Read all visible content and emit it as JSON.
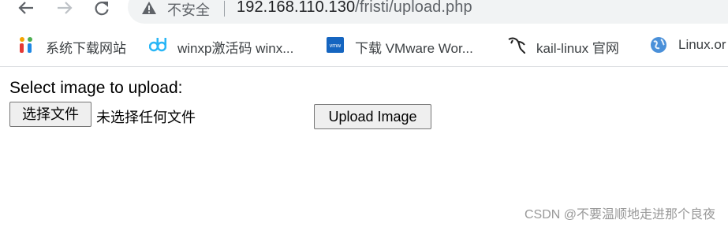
{
  "browser": {
    "security_label": "不安全",
    "url_host": "192.168.110.130",
    "url_path": "/fristi/upload.php"
  },
  "bookmarks": [
    {
      "label": "系统下载网站",
      "icon": "system-download-icon"
    },
    {
      "label": "winxp激活码 winx...",
      "icon": "winxp-icon"
    },
    {
      "label": "下载 VMware Wor...",
      "icon": "vmware-icon"
    },
    {
      "label": "kail-linux 官网",
      "icon": "kali-dragon-icon"
    },
    {
      "label": "Linux.or",
      "icon": "globe-icon"
    }
  ],
  "form": {
    "heading": "Select image to upload:",
    "choose_file_label": "选择文件",
    "no_file_text": "未选择任何文件",
    "upload_label": "Upload Image"
  },
  "watermark": "CSDN @不要温顺地走进那个良夜"
}
